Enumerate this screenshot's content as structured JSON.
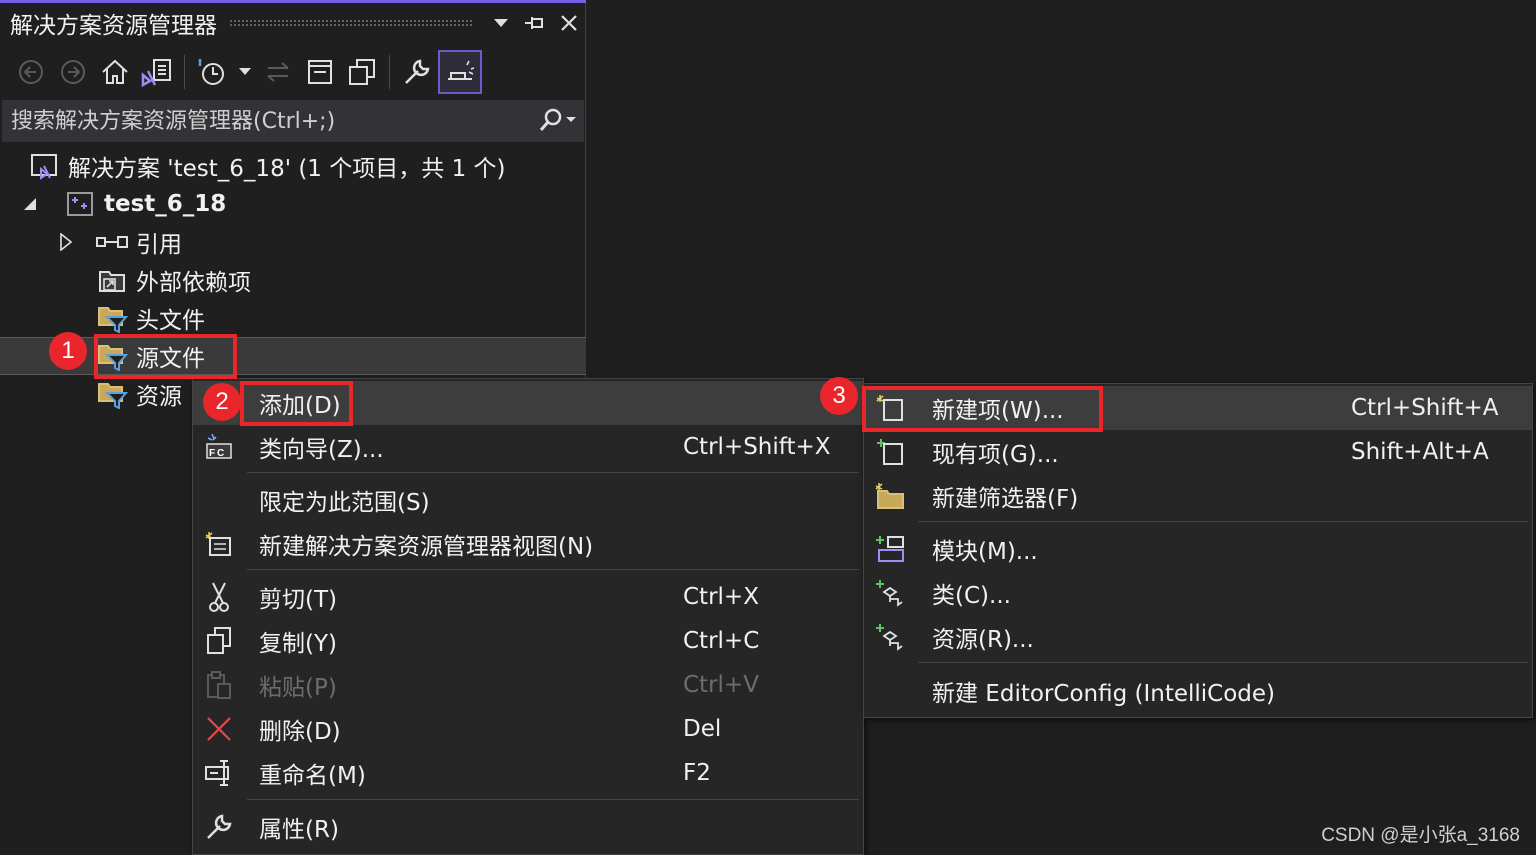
{
  "panel": {
    "title": "解决方案资源管理器",
    "controls": [
      "▾",
      "⊣",
      "✕"
    ],
    "search": {
      "placeholder": "搜索解决方案资源管理器(Ctrl+;)"
    },
    "tree": {
      "solution": "解决方案 'test_6_18' (1 个项目，共 1 个)",
      "project": "test_6_18",
      "references": "引用",
      "external_deps": "外部依赖项",
      "header_files": "头文件",
      "source_files": "源文件",
      "resource_files": "资源"
    }
  },
  "annotations": {
    "step1": "1",
    "step2": "2",
    "step3": "3"
  },
  "context_menu": {
    "add": "添加(D)",
    "class_wizard": {
      "label": "类向导(Z)...",
      "shortcut": "Ctrl+Shift+X"
    },
    "scope": "限定为此范围(S)",
    "new_view": "新建解决方案资源管理器视图(N)",
    "cut": {
      "label": "剪切(T)",
      "shortcut": "Ctrl+X"
    },
    "copy": {
      "label": "复制(Y)",
      "shortcut": "Ctrl+C"
    },
    "paste": {
      "label": "粘贴(P)",
      "shortcut": "Ctrl+V",
      "disabled": true
    },
    "delete": {
      "label": "删除(D)",
      "shortcut": "Del"
    },
    "rename": {
      "label": "重命名(M)",
      "shortcut": "F2"
    },
    "properties": "属性(R)"
  },
  "submenu": {
    "new_item": {
      "label": "新建项(W)...",
      "shortcut": "Ctrl+Shift+A"
    },
    "existing_item": {
      "label": "现有项(G)...",
      "shortcut": "Shift+Alt+A"
    },
    "new_filter": "新建筛选器(F)",
    "module": "模块(M)...",
    "class": "类(C)...",
    "resource": "资源(R)...",
    "editorconfig": "新建 EditorConfig (IntelliCode)"
  },
  "watermark": "CSDN @是小张a_3168",
  "colors": {
    "accent": "#7160e8",
    "annotation_red": "#e8262b",
    "background": "#1f1f1f",
    "menu_bg": "#262626"
  }
}
